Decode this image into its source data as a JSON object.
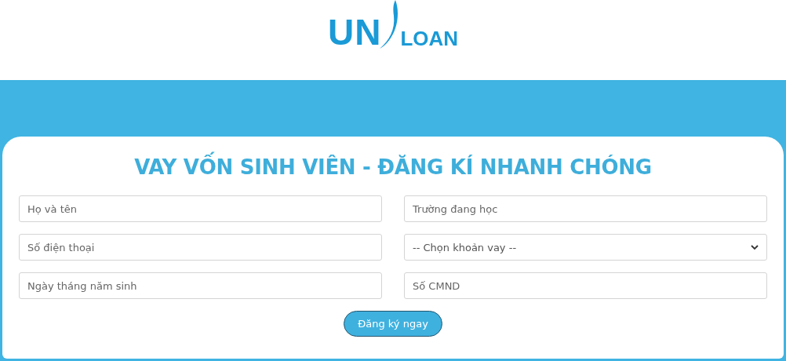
{
  "logo": {
    "left": "UN",
    "right": "LOAN"
  },
  "form": {
    "title": "VAY VỐN SINH VIÊN - ĐĂNG KÍ NHANH CHÓNG",
    "fields": [
      {
        "kind": "input",
        "placeholder": "Họ và tên"
      },
      {
        "kind": "input",
        "placeholder": "Trường đang học"
      },
      {
        "kind": "input",
        "placeholder": "Số điện thoại"
      },
      {
        "kind": "select",
        "value": "-- Chọn khoản vay --"
      },
      {
        "kind": "input",
        "placeholder": "Ngày tháng năm sinh"
      },
      {
        "kind": "input",
        "placeholder": "Số CMND"
      }
    ],
    "submit": "Đăng ký ngay"
  }
}
